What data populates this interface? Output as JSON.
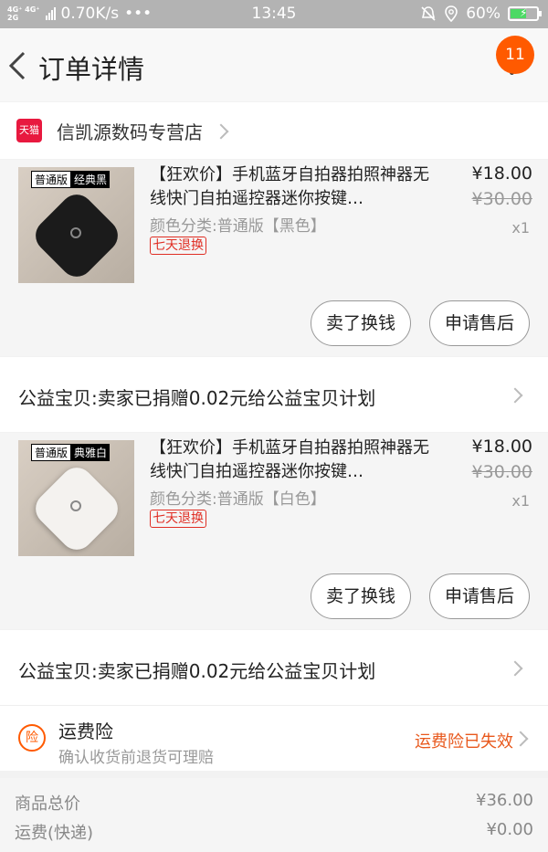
{
  "status_bar": {
    "network_top": "4G⁺ 4G⁺",
    "network_bottom": "2G",
    "speed": "0.70K/s",
    "dots": "•••",
    "time": "13:45",
    "battery": "60%",
    "battery_level": 0.6
  },
  "header": {
    "title": "订单详情",
    "badge": "11"
  },
  "store": {
    "badge": "天猫",
    "name": "信凯源数码专营店"
  },
  "items": [
    {
      "title": "【狂欢价】手机蓝牙自拍器拍照神器无线快门自拍遥控器迷你按键…",
      "attr": "颜色分类:普通版【黑色】",
      "guarantee": "七天退换",
      "price": "¥18.00",
      "original_price": "¥30.00",
      "qty": "x1",
      "thumb_tag_a": "普通版",
      "thumb_tag_b": "经典黑",
      "sell_label": "卖了换钱",
      "after_sale_label": "申请售后",
      "charity": "公益宝贝:卖家已捐赠0.02元给公益宝贝计划"
    },
    {
      "title": "【狂欢价】手机蓝牙自拍器拍照神器无线快门自拍遥控器迷你按键…",
      "attr": "颜色分类:普通版【白色】",
      "guarantee": "七天退换",
      "price": "¥18.00",
      "original_price": "¥30.00",
      "qty": "x1",
      "thumb_tag_a": "普通版",
      "thumb_tag_b": "典雅白",
      "sell_label": "卖了换钱",
      "after_sale_label": "申请售后",
      "charity": "公益宝贝:卖家已捐赠0.02元给公益宝贝计划"
    }
  ],
  "shipping_insurance": {
    "icon": "险",
    "title": "运费险",
    "subtitle": "确认收货前退货可理赔",
    "status": "运费险已失效"
  },
  "summary": {
    "goods_label": "商品总价",
    "goods_value": "¥36.00",
    "freight_label": "运费(快递)",
    "freight_value": "¥0.00"
  },
  "colors": {
    "accent": "#ff5a00",
    "tmall_red": "#e8193f",
    "status_bar": "#b3b3b3"
  }
}
